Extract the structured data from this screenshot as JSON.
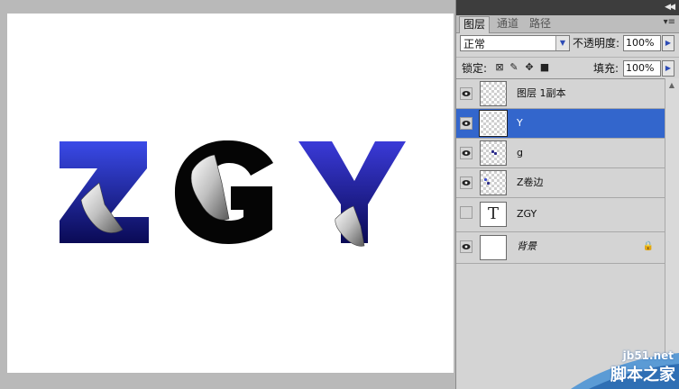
{
  "panel": {
    "tabs": [
      "图层",
      "通道",
      "路径"
    ],
    "blend_mode": "正常",
    "opacity_label": "不透明度:",
    "opacity_value": "100%",
    "lock_label": "锁定:",
    "fill_label": "填充:",
    "fill_value": "100%"
  },
  "layers": [
    {
      "name": "图层 1副本",
      "visible": true,
      "thumb": "transparent",
      "selected": false
    },
    {
      "name": "Y",
      "visible": true,
      "thumb": "transparent",
      "selected": true
    },
    {
      "name": "g",
      "visible": true,
      "thumb": "transparent",
      "selected": false
    },
    {
      "name": "Z卷边",
      "visible": true,
      "thumb": "transparent",
      "selected": false
    },
    {
      "name": "ZGY",
      "visible": false,
      "thumb": "text",
      "selected": false
    },
    {
      "name": "背景",
      "visible": true,
      "thumb": "white",
      "selected": false,
      "locked": true
    }
  ],
  "text_thumb_glyph": "T",
  "watermark": {
    "url": "jb51.net",
    "name": "脚本之家"
  },
  "colors": {
    "selection": "#3366cc",
    "z_top": "#3a4ae8",
    "z_bottom": "#0a0a55",
    "y_top": "#3a3ad8",
    "y_bottom": "#0a0a55"
  }
}
